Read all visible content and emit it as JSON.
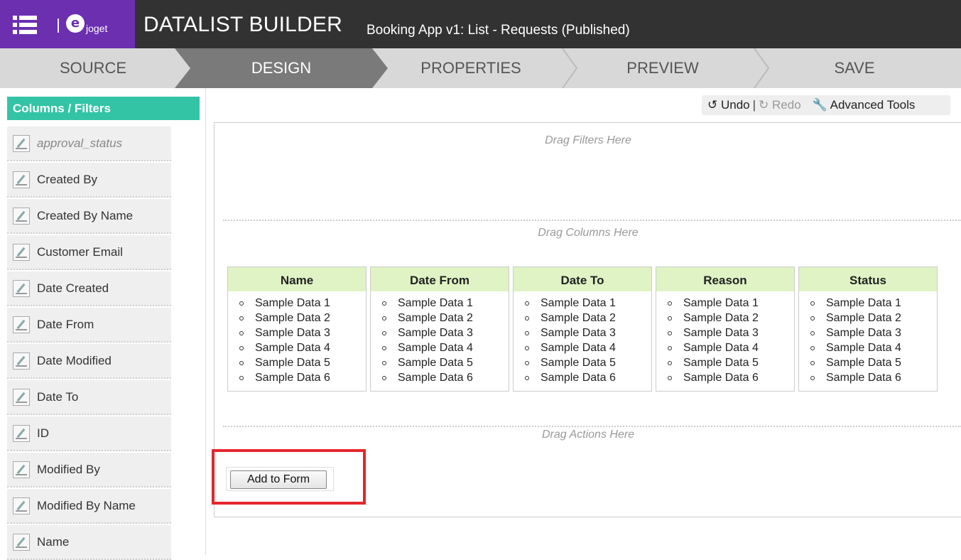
{
  "header": {
    "logo_text": "joget",
    "title": "DATALIST BUILDER",
    "subtitle": "Booking App v1: List - Requests (Published)",
    "brand_color": "#6b2fb0"
  },
  "steps": [
    {
      "label": "SOURCE",
      "active": false
    },
    {
      "label": "DESIGN",
      "active": true
    },
    {
      "label": "PROPERTIES",
      "active": false
    },
    {
      "label": "PREVIEW",
      "active": false
    },
    {
      "label": "SAVE",
      "active": false
    }
  ],
  "sidebar": {
    "title": "Columns / Filters",
    "items": [
      {
        "label": "approval_status"
      },
      {
        "label": "Created By"
      },
      {
        "label": "Created By Name"
      },
      {
        "label": "Customer Email"
      },
      {
        "label": "Date Created"
      },
      {
        "label": "Date From"
      },
      {
        "label": "Date Modified"
      },
      {
        "label": "Date To"
      },
      {
        "label": "ID"
      },
      {
        "label": "Modified By"
      },
      {
        "label": "Modified By Name"
      },
      {
        "label": "Name"
      }
    ]
  },
  "toolbar": {
    "undo": "Undo",
    "redo": "Redo",
    "advanced": "Advanced Tools"
  },
  "canvas": {
    "filters_hint": "Drag Filters Here",
    "columns_hint": "Drag Columns Here",
    "actions_hint": "Drag Actions Here",
    "columns": [
      {
        "header": "Name",
        "rows": [
          "Sample Data 1",
          "Sample Data 2",
          "Sample Data 3",
          "Sample Data 4",
          "Sample Data 5",
          "Sample Data 6"
        ]
      },
      {
        "header": "Date From",
        "rows": [
          "Sample Data 1",
          "Sample Data 2",
          "Sample Data 3",
          "Sample Data 4",
          "Sample Data 5",
          "Sample Data 6"
        ]
      },
      {
        "header": "Date To",
        "rows": [
          "Sample Data 1",
          "Sample Data 2",
          "Sample Data 3",
          "Sample Data 4",
          "Sample Data 5",
          "Sample Data 6"
        ]
      },
      {
        "header": "Reason",
        "rows": [
          "Sample Data 1",
          "Sample Data 2",
          "Sample Data 3",
          "Sample Data 4",
          "Sample Data 5",
          "Sample Data 6"
        ]
      },
      {
        "header": "Status",
        "rows": [
          "Sample Data 1",
          "Sample Data 2",
          "Sample Data 3",
          "Sample Data 4",
          "Sample Data 5",
          "Sample Data 6"
        ]
      }
    ],
    "action_button": "Add to Form"
  },
  "colors": {
    "header_bg": "#323232",
    "sidebar_header": "#33c4a6",
    "column_header": "#dff3c4",
    "highlight": "#e4262d"
  }
}
